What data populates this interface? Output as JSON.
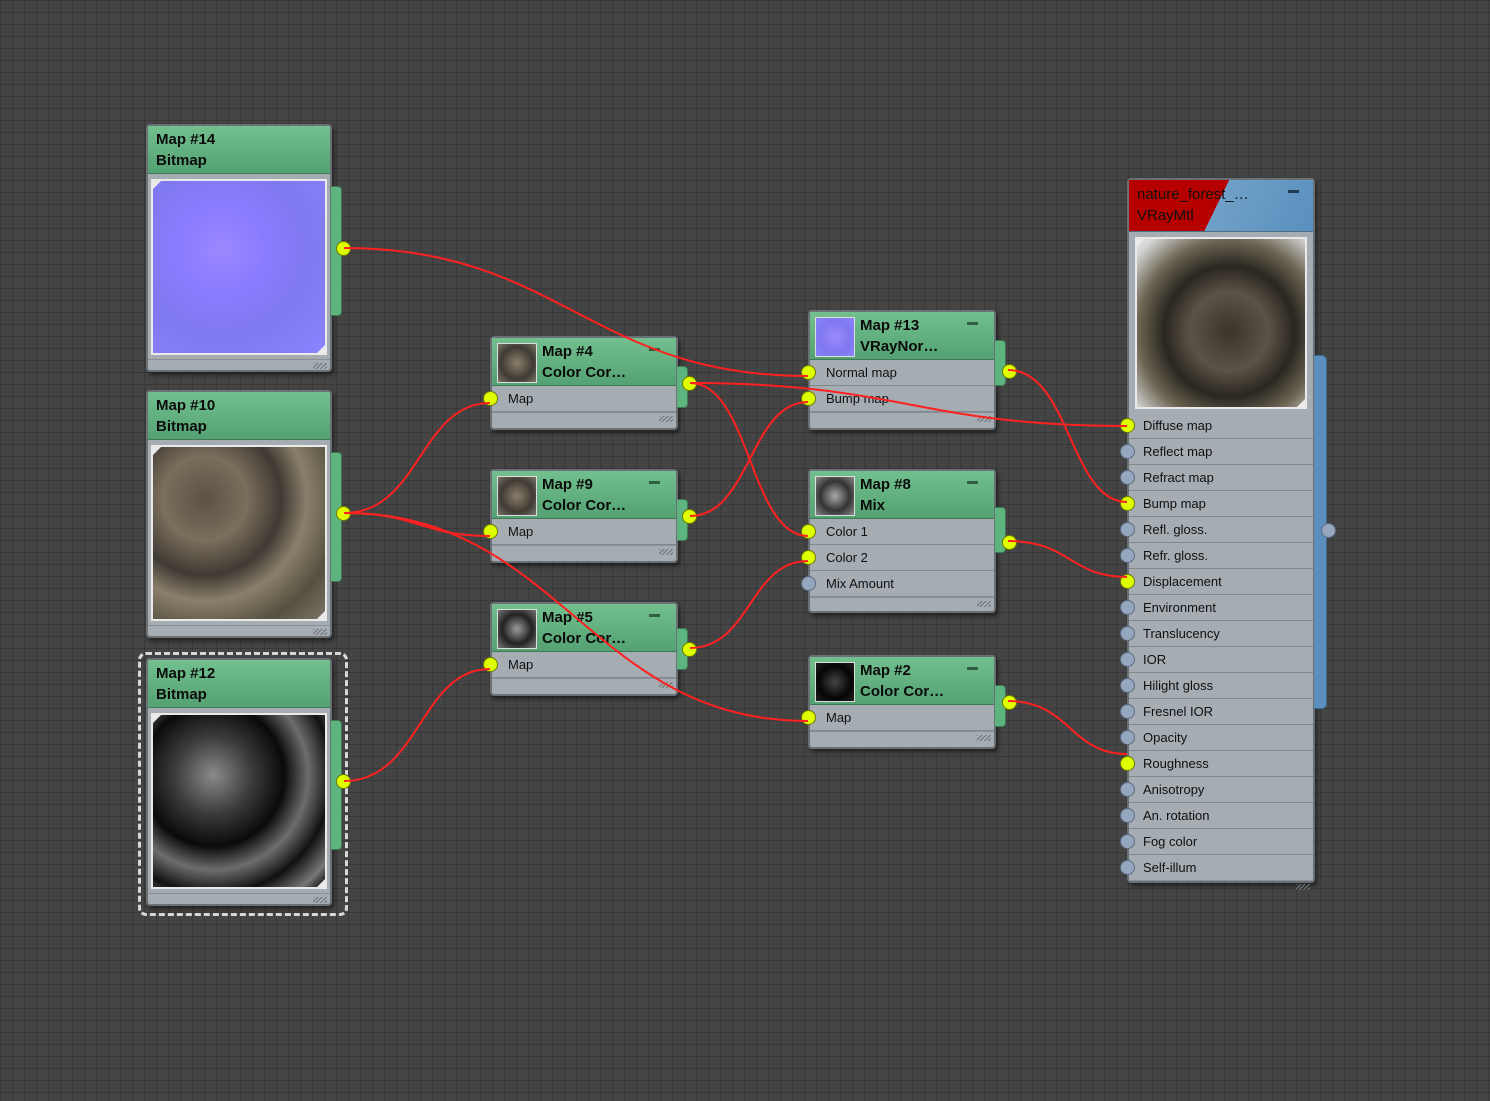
{
  "nodes": {
    "map14": {
      "title": "Map #14",
      "subtitle": "Bitmap"
    },
    "map10": {
      "title": "Map #10",
      "subtitle": "Bitmap"
    },
    "map12": {
      "title": "Map #12",
      "subtitle": "Bitmap"
    },
    "map4": {
      "title": "Map #4",
      "subtitle": "Color Cor…",
      "slots": [
        "Map"
      ]
    },
    "map9": {
      "title": "Map #9",
      "subtitle": "Color Cor…",
      "slots": [
        "Map"
      ]
    },
    "map5": {
      "title": "Map #5",
      "subtitle": "Color Cor…",
      "slots": [
        "Map"
      ]
    },
    "map13": {
      "title": "Map #13",
      "subtitle": "VRayNor…",
      "slots": [
        "Normal map",
        "Bump map"
      ]
    },
    "map8": {
      "title": "Map #8",
      "subtitle": "Mix",
      "slots": [
        "Color 1",
        "Color 2",
        "Mix Amount"
      ]
    },
    "map2": {
      "title": "Map #2",
      "subtitle": "Color Cor…",
      "slots": [
        "Map"
      ]
    },
    "material": {
      "title": "nature_forest_…",
      "subtitle": "VRayMtl",
      "slots": [
        "Diffuse map",
        "Reflect map",
        "Refract map",
        "Bump map",
        "Refl. gloss.",
        "Refr. gloss.",
        "Displacement",
        "Environment",
        "Translucency",
        "IOR",
        "Hilight gloss",
        "Fresnel IOR",
        "Opacity",
        "Roughness",
        "Anisotropy",
        "An. rotation",
        "Fog color",
        "Self-illum"
      ]
    }
  },
  "colors": {
    "wire": "#ff2020",
    "socket_connected": "#ddff00",
    "socket_empty": "#95a6bf",
    "map_header": "#5db47f",
    "material_header_red": "#b60000",
    "material_header_blue": "#6fa0c8"
  }
}
